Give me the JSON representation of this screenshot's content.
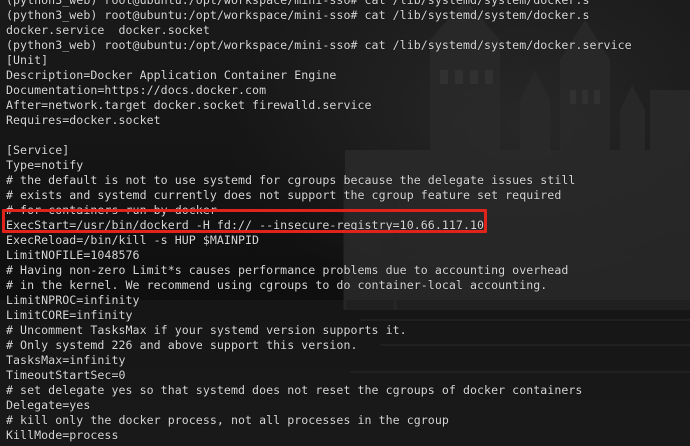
{
  "terminal": {
    "lines": [
      "(python3_web) root@ubuntu:/opt/workspace/mini-sso# cat /lib/systemd/system/docker.s",
      "(python3_web) root@ubuntu:/opt/workspace/mini-sso# cat /lib/systemd/system/docker.s",
      "docker.service  docker.socket",
      "(python3_web) root@ubuntu:/opt/workspace/mini-sso# cat /lib/systemd/system/docker.service",
      "[Unit]",
      "Description=Docker Application Container Engine",
      "Documentation=https://docs.docker.com",
      "After=network.target docker.socket firewalld.service",
      "Requires=docker.socket",
      "",
      "[Service]",
      "Type=notify",
      "# the default is not to use systemd for cgroups because the delegate issues still",
      "# exists and systemd currently does not support the cgroup feature set required",
      "# for containers run by docker",
      "ExecStart=/usr/bin/dockerd -H fd:// --insecure-registry=10.66.117.10",
      "ExecReload=/bin/kill -s HUP $MAINPID",
      "LimitNOFILE=1048576",
      "# Having non-zero Limit*s causes performance problems due to accounting overhead",
      "# in the kernel. We recommend using cgroups to do container-local accounting.",
      "LimitNPROC=infinity",
      "LimitCORE=infinity",
      "# Uncomment TasksMax if your systemd version supports it.",
      "# Only systemd 226 and above support this version.",
      "TasksMax=infinity",
      "TimeoutStartSec=0",
      "# set delegate yes so that systemd does not reset the cgroups of docker containers",
      "Delegate=yes",
      "# kill only the docker process, not all processes in the cgroup",
      "KillMode=process"
    ]
  },
  "highlight": {
    "color": "#e0241c",
    "line_index": 15
  },
  "colors": {
    "text": "#d7d7d7",
    "background": "#121212"
  }
}
